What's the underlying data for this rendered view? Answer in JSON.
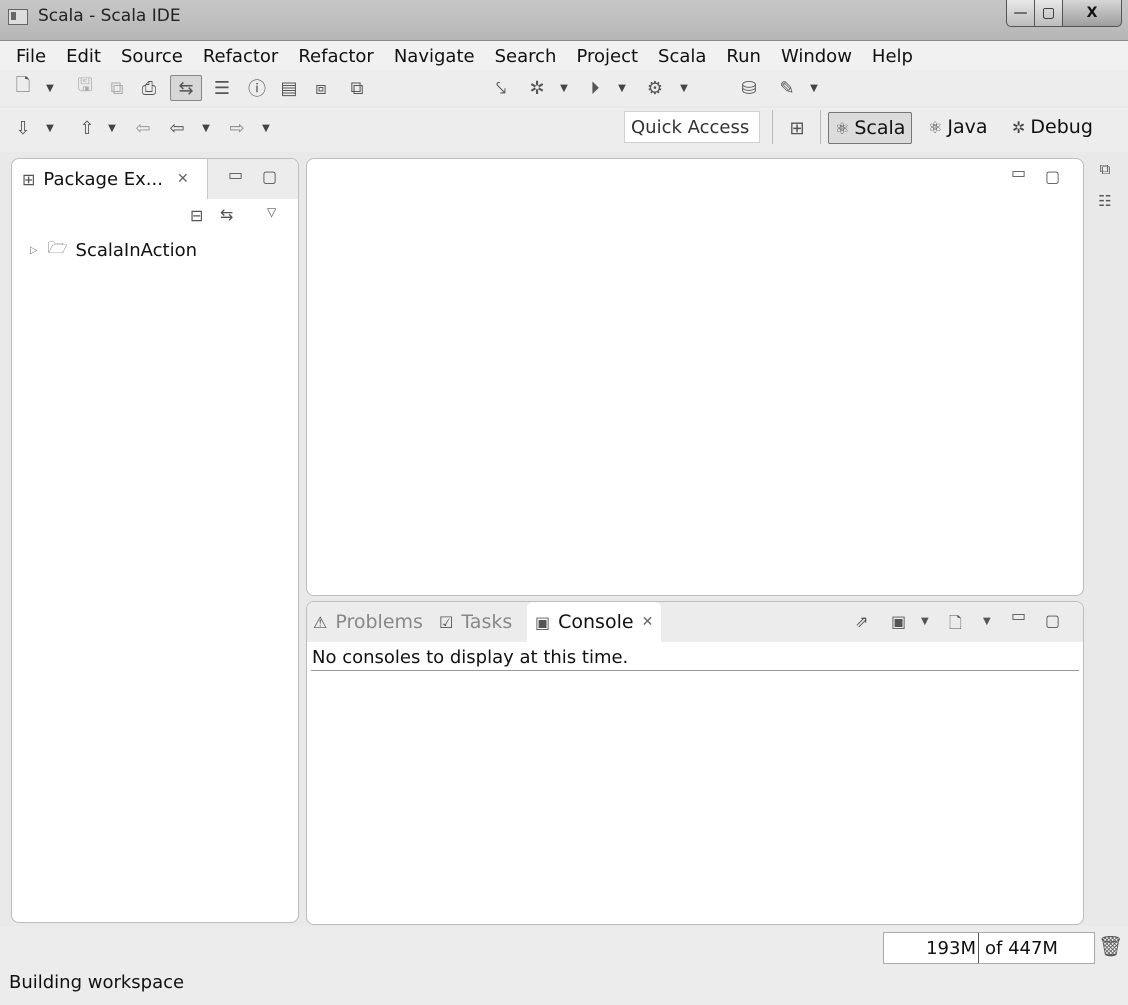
{
  "window": {
    "title": "Scala - Scala IDE",
    "min_label": "▭",
    "max_label": "▢",
    "close_label": "X"
  },
  "menu": [
    "File",
    "Edit",
    "Source",
    "Refactor",
    "Refactor",
    "Navigate",
    "Search",
    "Project",
    "Scala",
    "Run",
    "Window",
    "Help"
  ],
  "toolbar": {
    "quick_access": "Quick Access",
    "perspectives": [
      {
        "label": "Scala",
        "icon": "scala-perspective-icon",
        "active": true
      },
      {
        "label": "Java",
        "icon": "java-perspective-icon",
        "active": false
      },
      {
        "label": "Debug",
        "icon": "debug-perspective-icon",
        "active": false
      }
    ]
  },
  "package_explorer": {
    "tab_label": "Package Ex...",
    "items": [
      {
        "label": "ScalaInAction",
        "icon": "scala-project-folder-icon"
      }
    ]
  },
  "bottom_panel": {
    "tabs": [
      {
        "label": "Problems",
        "active": false
      },
      {
        "label": "Tasks",
        "active": false
      },
      {
        "label": "Console",
        "active": true
      }
    ],
    "message": "No consoles to display at this time."
  },
  "status": {
    "heap_used": "193M",
    "heap_total": "of 447M",
    "message": "Building workspace"
  }
}
